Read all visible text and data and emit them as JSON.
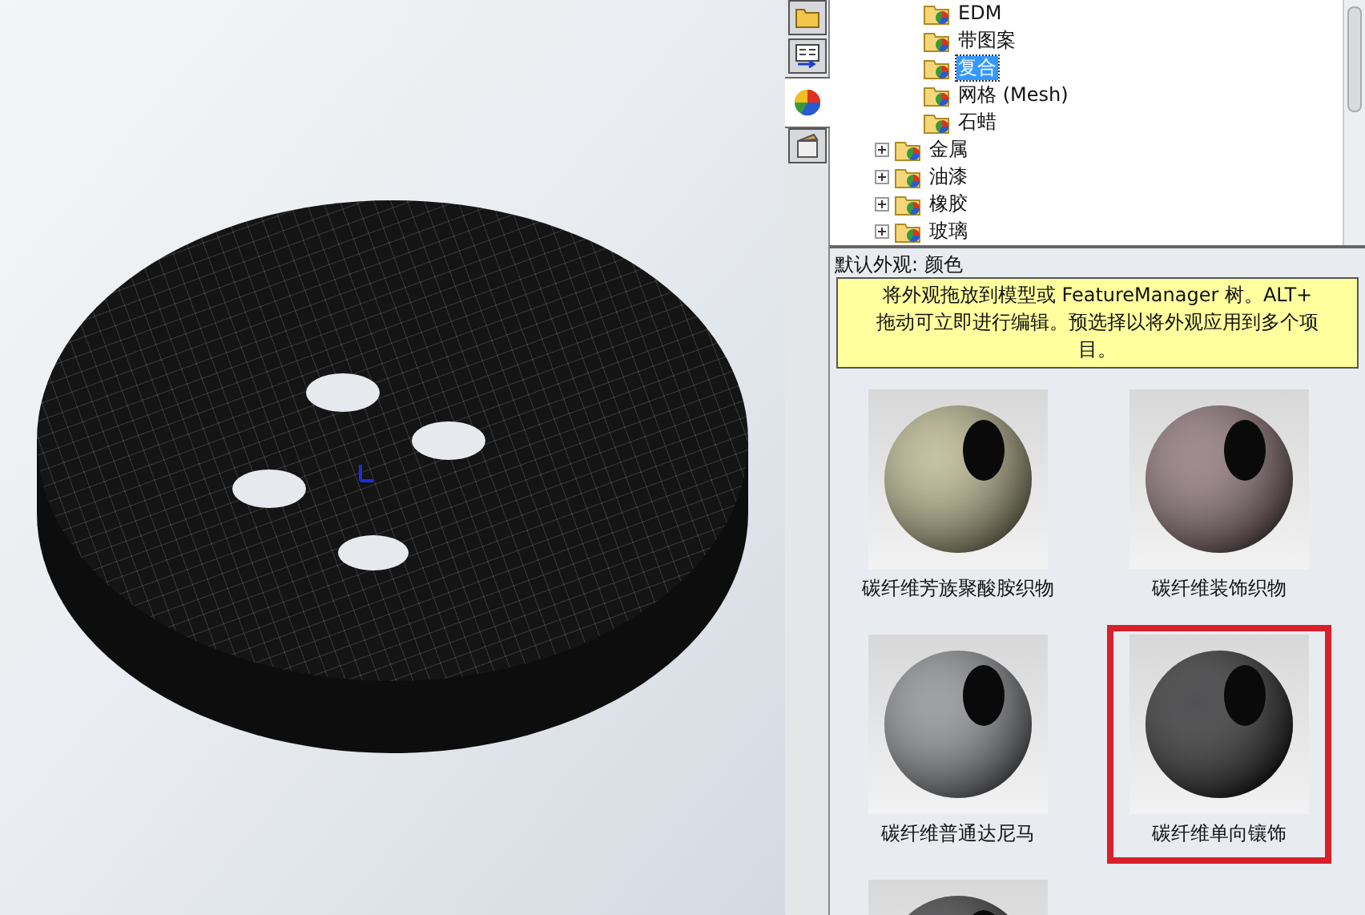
{
  "side_tabs": [
    {
      "kind": "folder",
      "selected": false
    },
    {
      "kind": "tree",
      "selected": false
    },
    {
      "kind": "appearance",
      "selected": true
    },
    {
      "kind": "scene",
      "selected": false
    }
  ],
  "tree": {
    "items": [
      {
        "children": [
          {
            "label": "EDM",
            "selected": false
          },
          {
            "label": "带图案",
            "selected": false
          },
          {
            "label": "复合",
            "selected": true
          },
          {
            "label": "网格 (Mesh)",
            "selected": false
          },
          {
            "label": "石蜡",
            "selected": false
          }
        ]
      },
      {
        "label": "金属",
        "expanded": false
      },
      {
        "label": "油漆",
        "expanded": false
      },
      {
        "label": "橡胶",
        "expanded": false
      },
      {
        "label": "玻璃",
        "expanded": false
      }
    ]
  },
  "default_appearance": "默认外观: 颜色",
  "hint": "将外观拖放到模型或 FeatureManager 树。ALT+ 拖动可立即进行编辑。预选择以将外观应用到多个项目。",
  "swatches": [
    {
      "label": "碳纤维芳族聚酸胺织物",
      "color": "#b8b48a",
      "selected": false
    },
    {
      "label": "碳纤维装饰织物",
      "color": "#8a7074",
      "selected": false
    },
    {
      "label": "碳纤维普通达尼马",
      "color": "#8a8c90",
      "selected": false
    },
    {
      "label": "碳纤维单向镶饰",
      "color": "#2a2a2c",
      "selected": true
    },
    {
      "color": "#3a3a3c",
      "selected": false
    }
  ]
}
